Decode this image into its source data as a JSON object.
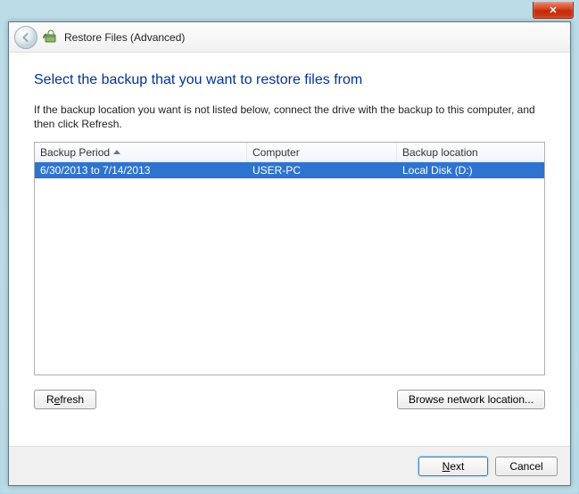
{
  "titlebar": {
    "close_glyph": "✕"
  },
  "header": {
    "title": "Restore Files (Advanced)"
  },
  "main": {
    "heading": "Select the backup that you want to restore files from",
    "instruction": "If the backup location you want is not listed below, connect the drive with the backup to this computer, and then click Refresh.",
    "columns": {
      "period": "Backup Period",
      "computer": "Computer",
      "location": "Backup location"
    },
    "rows": [
      {
        "period": "6/30/2013 to 7/14/2013",
        "computer": "USER-PC",
        "location": "Local Disk (D:)",
        "selected": true
      }
    ],
    "buttons": {
      "refresh_pre": "R",
      "refresh_ul": "e",
      "refresh_post": "fresh",
      "browse": "Browse network location..."
    }
  },
  "footer": {
    "next_pre": "",
    "next_ul": "N",
    "next_post": "ext",
    "cancel": "Cancel"
  }
}
